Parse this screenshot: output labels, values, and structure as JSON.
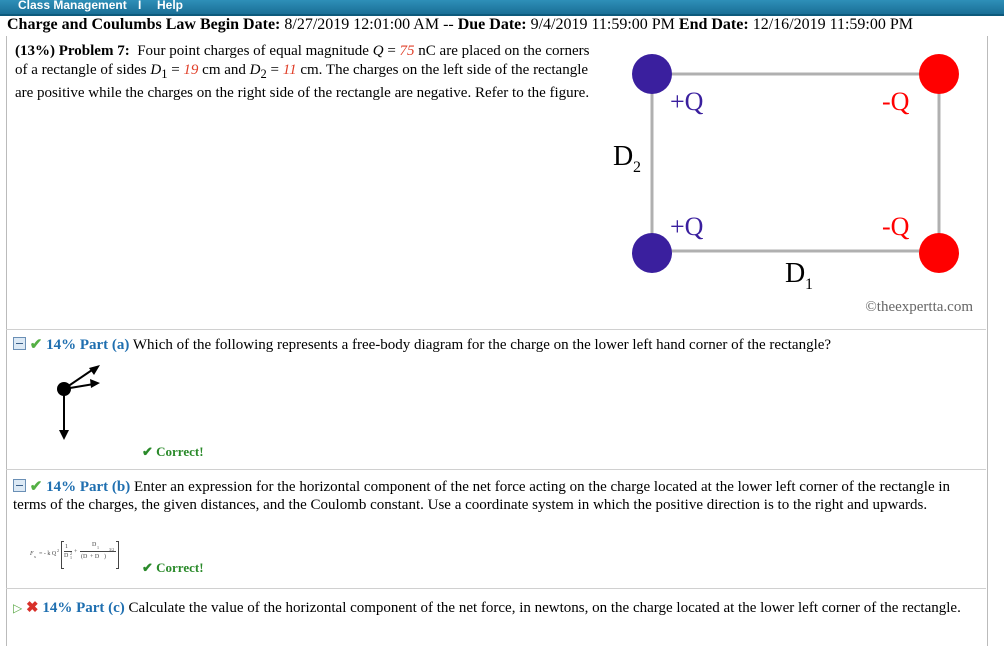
{
  "topbar": {
    "class_management": "Class Management",
    "sep": "I",
    "help": "Help"
  },
  "header": {
    "title": "Charge and Coulumbs Law",
    "begin_label": "Begin Date:",
    "begin": "8/27/2019 12:01:00 AM",
    "dash": "--",
    "due_label": "Due Date:",
    "due": "9/4/2019 11:59:00 PM",
    "end_label": "End Date:",
    "end": "12/16/2019 11:59:00 PM"
  },
  "problem": {
    "label": "(13%) Problem 7:",
    "t1": "Four point charges of equal magnitude ",
    "q_sym": "Q",
    "t2": " = ",
    "q_val": "75",
    "t3": " nC are placed on the corners of a rectangle of sides ",
    "d1_sym": "D",
    "d1_sub": "1",
    "t4": " = ",
    "d1_val": "19",
    "t5": " cm and ",
    "d2_sym": "D",
    "d2_sub": "2",
    "t6": " = ",
    "d2_val": "11",
    "t7": " cm. The charges on the left side of the rectangle are positive while the charges on the right side of the rectangle are negative. Refer to the figure."
  },
  "figure": {
    "top_left": "+Q",
    "top_right": "-Q",
    "bottom_left": "+Q",
    "bottom_right": "-Q",
    "d2_main": "D",
    "d2_sub": "2",
    "d1_main": "D",
    "d1_sub": "1",
    "copyright": "©theexpertta.com",
    "positive_color": "#3a1f9e",
    "negative_color": "#ff0000"
  },
  "part_a": {
    "pct": "14% Part (a)",
    "text": "Which of the following represents a free-body diagram for the charge on the lower left hand corner of the rectangle?",
    "status": "✔ Correct!"
  },
  "part_b": {
    "pct": "14% Part (b)",
    "text": "Enter an expression for the horizontal component of the net force acting on the charge located at the lower left corner of the rectangle in terms of the charges, the given distances, and the Coulomb constant. Use a coordinate system in which the positive direction is to the right and upwards.",
    "formula_lhs": "F",
    "formula_sub": "x",
    "formula_eq": "= - k Q",
    "formula_sup": "2",
    "formula_num1": "1",
    "formula_den1": "D",
    "formula_den1_sub": "1",
    "formula_den1_sup": "2",
    "formula_num2": "D",
    "formula_num2_sub": "1",
    "formula_den2": "(D",
    "formula_den2_rest": " + D",
    "formula_den2_tail": ")",
    "formula_exp": "3/2",
    "status": "✔ Correct!"
  },
  "part_c": {
    "pct": "14% Part (c)",
    "text": "Calculate the value of the horizontal component of the net force, in newtons, on the charge located at the lower left corner of the rectangle."
  }
}
